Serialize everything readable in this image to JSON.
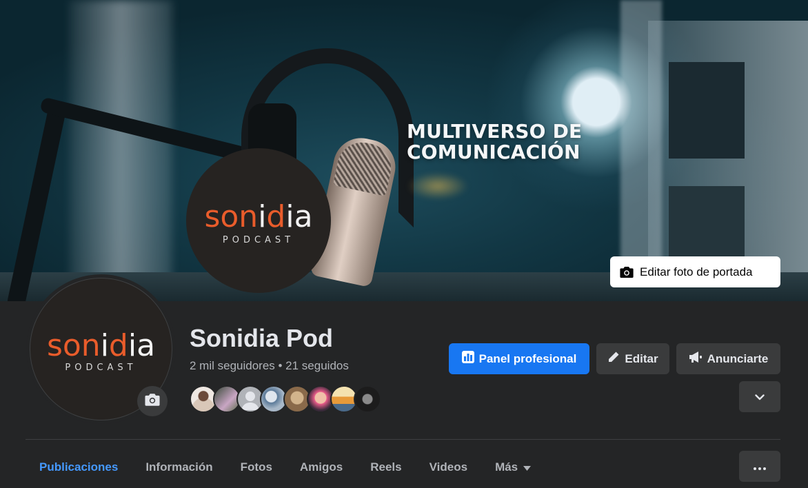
{
  "cover": {
    "title_line1": "MULTIVERSO DE",
    "title_line2": "COMUNICACIÓN",
    "edit_button_label": "Editar foto de portada",
    "camera_icon": "camera-icon"
  },
  "logo": {
    "word_orange": "son",
    "word_white_1": "i",
    "word_orange_2": "d",
    "word_white_2": "ia",
    "sub": "PODCAST",
    "colors": {
      "orange": "#e95c2b",
      "white": "#f2f2f2",
      "background": "#262321"
    }
  },
  "profile": {
    "name": "Sonidia Pod",
    "stats": "2 mil seguidores • 21 seguidos",
    "camera_icon": "camera-icon"
  },
  "followers": [
    {
      "color_a": "#d9c7b8",
      "color_b": "#6b4a3a"
    },
    {
      "color_a": "#3a4a3a",
      "color_b": "#c9a6c4"
    },
    {
      "color_a": "#b0b3b8",
      "color_b": "#e4e6eb",
      "default": true
    },
    {
      "color_a": "#5b7a99",
      "color_b": "#dfe6ee"
    },
    {
      "color_a": "#8a6a4a",
      "color_b": "#d2b48c"
    },
    {
      "color_a": "#e85b8a",
      "color_b": "#3a2a3a"
    },
    {
      "color_a": "#e79a3a",
      "color_b": "#f4e2b0"
    },
    {
      "color_a": "#1c1c1c",
      "color_b": "#8a8a8a"
    }
  ],
  "actions": {
    "professional_panel": "Panel profesional",
    "edit": "Editar",
    "advertise": "Anunciarte",
    "expand_icon": "chevron-down-icon",
    "colors": {
      "primary": "#1877f2",
      "secondary": "#3a3b3c"
    }
  },
  "tabs": [
    {
      "label": "Publicaciones",
      "active": true
    },
    {
      "label": "Información"
    },
    {
      "label": "Fotos"
    },
    {
      "label": "Amigos"
    },
    {
      "label": "Reels"
    },
    {
      "label": "Videos"
    },
    {
      "label": "Más",
      "dropdown": true
    }
  ],
  "more_menu_icon": "more-dots-icon",
  "theme": {
    "background": "#242526",
    "active_tab": "#4599ff",
    "muted_text": "#b0b3b8"
  }
}
